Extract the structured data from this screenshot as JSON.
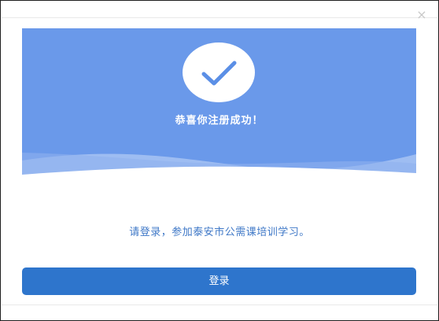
{
  "dialog": {
    "close_label": "×",
    "success_title": "恭喜你注册成功！",
    "info_text": "请登录，参加泰安市公需课培训学习。",
    "login_label": "登录"
  },
  "icons": {
    "close": "close-icon",
    "check": "checkmark-icon"
  },
  "colors": {
    "banner": "#6a99ea",
    "wave": "#9fbdf2",
    "check": "#5b8fe6",
    "info_text": "#3f78c7",
    "button": "#2e75cc"
  }
}
